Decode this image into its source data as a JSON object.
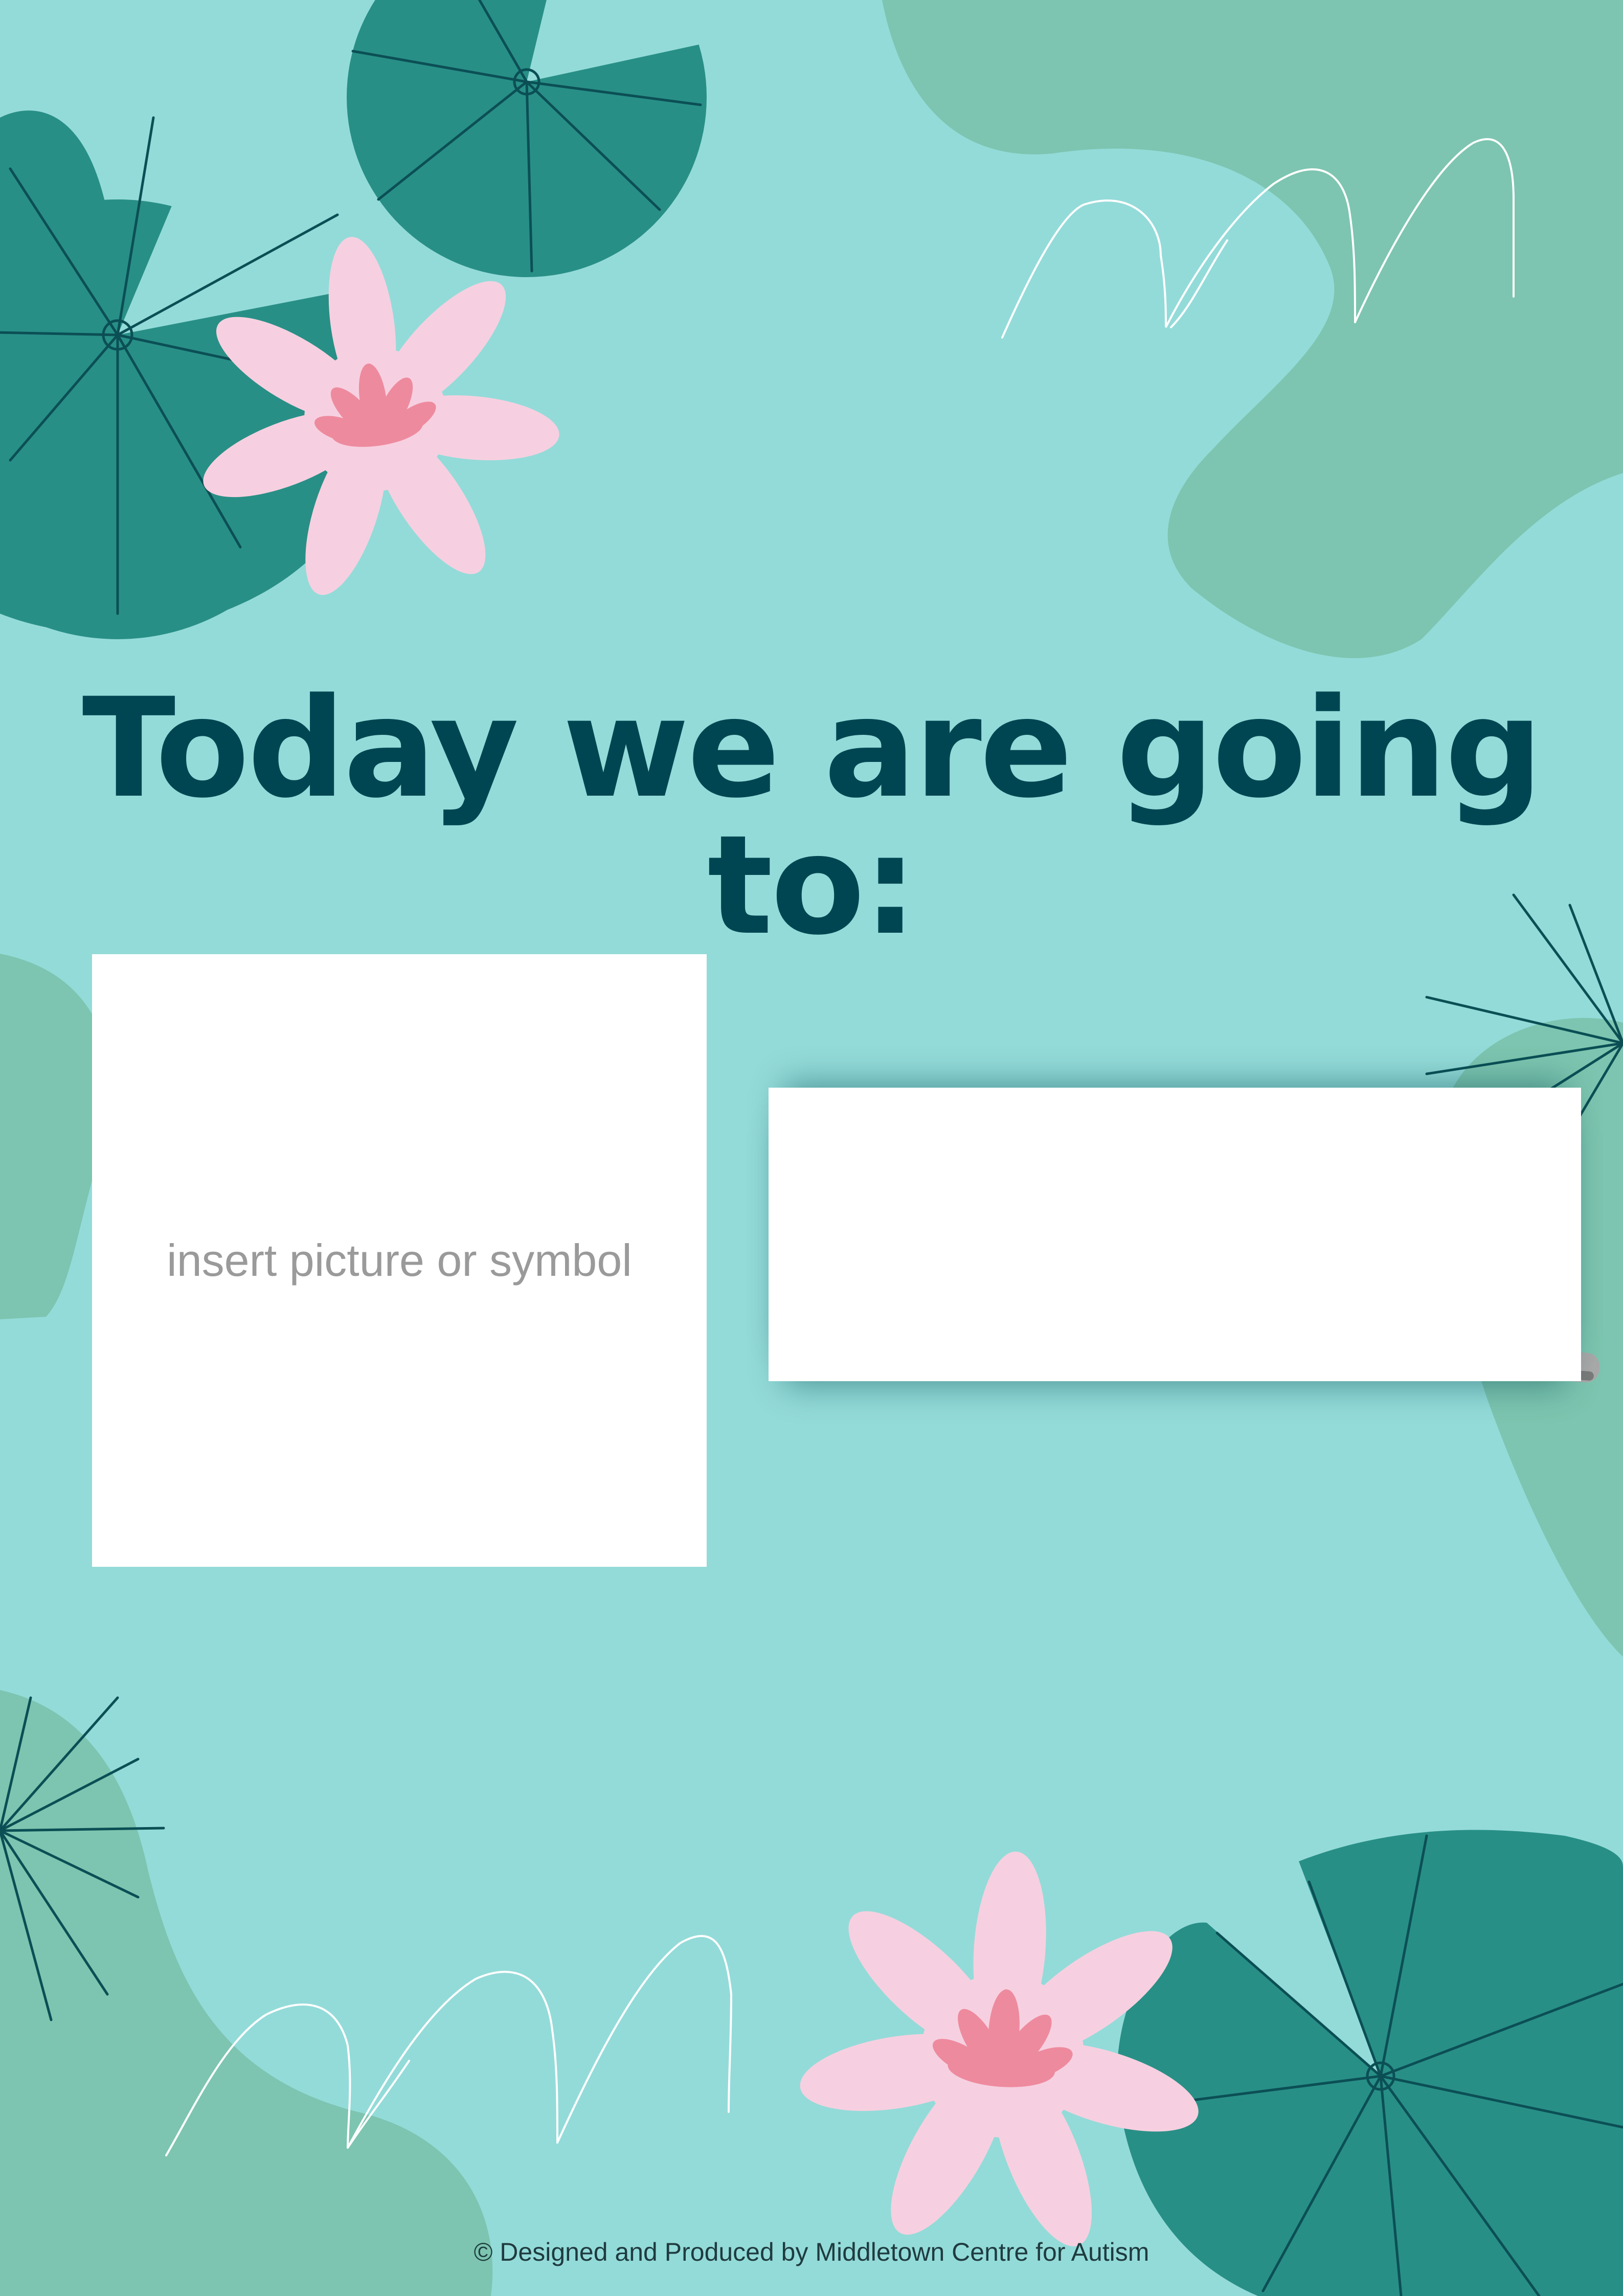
{
  "page": {
    "background_color": "#93dbd9"
  },
  "heading": {
    "text": "Today we are going to:",
    "color": "#004652"
  },
  "picture_box": {
    "placeholder": "insert picture or symbol",
    "placeholder_color": "#9a9a9a"
  },
  "footer": {
    "text": "© Designed and Produced by Middletown Centre for Autism",
    "color": "#1f3b3f"
  },
  "decor": {
    "lily_pad_color": "#288f86",
    "lily_pad_vein_color": "#0b4f55",
    "blob_color": "#7dc5b0",
    "flower_petal_color": "#f6d0e0",
    "flower_center_color": "#ee8a9e",
    "grass_stroke_color": "#ffffff",
    "marker_body_color": "#a9a9a9",
    "marker_cap_color": "#1a1a1a",
    "icons": [
      "lily-pad-icon",
      "water-lily-icon",
      "grass-icon",
      "marker-pen-icon"
    ]
  }
}
